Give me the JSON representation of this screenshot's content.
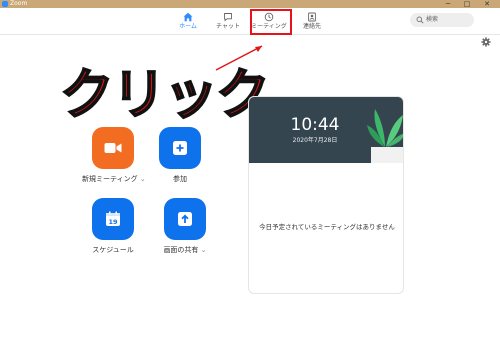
{
  "window": {
    "title": "Zoom",
    "controls": {
      "minimize": "─",
      "maximize": "□",
      "close": "✕"
    }
  },
  "nav": {
    "tabs": [
      {
        "label": "ホーム",
        "icon": "home-icon",
        "active": true
      },
      {
        "label": "チャット",
        "icon": "chat-icon",
        "active": false
      },
      {
        "label": "ミーティング",
        "icon": "clock-icon",
        "active": false,
        "highlighted": true
      },
      {
        "label": "連絡先",
        "icon": "contacts-icon",
        "active": false
      }
    ],
    "search": {
      "placeholder": "検索",
      "icon": "search-icon"
    },
    "settings_icon": "gear-icon"
  },
  "annotation": {
    "text": "クリック",
    "color": "#e01616"
  },
  "actions": [
    {
      "label": "新規ミーティング",
      "caret": "⌄",
      "icon": "video-camera-icon",
      "color": "#f26d21"
    },
    {
      "label": "参加",
      "icon": "plus-icon",
      "color": "#0e72ed"
    },
    {
      "label": "スケジュール",
      "icon": "calendar-icon",
      "calendar_day": "19",
      "color": "#0e72ed"
    },
    {
      "label": "画面の共有",
      "caret": "⌄",
      "icon": "share-arrow-icon",
      "color": "#0e72ed"
    }
  ],
  "calendar_card": {
    "time": "10:44",
    "date": "2020年7月28日",
    "empty_message": "今日予定されているミーティングはありません"
  },
  "colors": {
    "accent": "#2d8cff",
    "highlight_box": "#e8121b",
    "banner": "#35454f"
  }
}
